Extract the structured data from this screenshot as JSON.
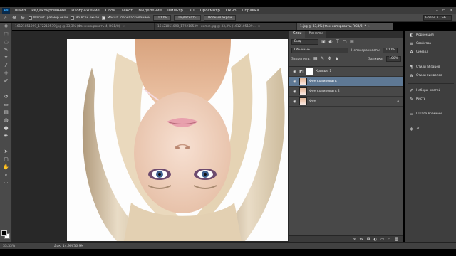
{
  "app": {
    "logo": "Ps"
  },
  "menu": [
    "Файл",
    "Редактирование",
    "Изображение",
    "Слои",
    "Текст",
    "Выделение",
    "Фильтр",
    "3D",
    "Просмотр",
    "Окно",
    "Справка"
  ],
  "options_bar": {
    "resize_windows": "Масшт. размер окон",
    "all_windows": "Во всех окнах",
    "scrubby_zoom": "Масшт. перетаскиванием",
    "zoom_100": "100%",
    "fit_screen": "Подогнать",
    "fill_screen": "Полный экран",
    "workspace": "Новое в CS6"
  },
  "tabs": [
    {
      "label": "16121051099_172210539.jpg @ 33,3% (Фон копировать 4, RGB/8)",
      "active": false
    },
    {
      "label": "16121051098_172210539 - копия.jpg @ 33,3% (1612105109...",
      "active": false
    },
    {
      "label": "1.jpg @ 33,3% (Фон копировать, RGB/8) *",
      "active": true
    }
  ],
  "layers_panel": {
    "tabs": [
      "Слои",
      "Каналы"
    ],
    "kind_filter": "Вид",
    "blend_mode": "Обычные",
    "opacity_label": "Непрозрачность:",
    "opacity_value": "100%",
    "lock_label": "Закрепить:",
    "fill_label": "Заливка:",
    "fill_value": "100%",
    "layers": [
      {
        "name": "Кривые 1",
        "thumb": "white",
        "selected": false
      },
      {
        "name": "Фон копировать",
        "thumb": "face",
        "selected": true
      },
      {
        "name": "Фон копировать 2",
        "thumb": "face",
        "selected": false
      },
      {
        "name": "Фон",
        "thumb": "face",
        "selected": false,
        "locked": true
      }
    ]
  },
  "dock": {
    "group1": [
      "Коррекция",
      "Свойства",
      "Символ"
    ],
    "group2": [
      "Стили абзацев",
      "Стили символов"
    ],
    "group3": [
      "Наборы кистей",
      "Кисть"
    ],
    "group4": [
      "Шкала времени"
    ],
    "group5": [
      "3D"
    ]
  },
  "status": {
    "zoom": "33,33%",
    "doc": "Док: 14,9М/36,9М"
  },
  "colors": {
    "selection": "#5e7894",
    "chrome": "#4a4a4a",
    "canvas_bg": "#282828"
  }
}
